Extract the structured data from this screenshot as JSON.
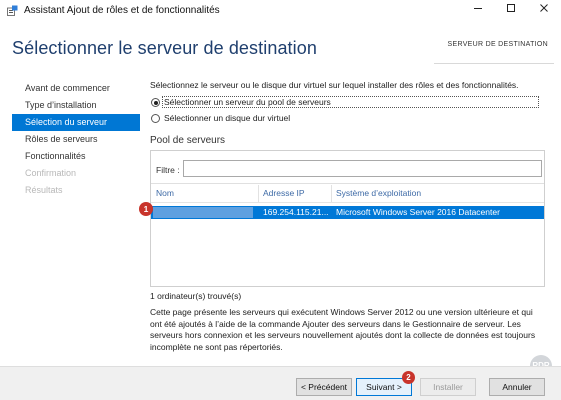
{
  "window": {
    "title": "Assistant Ajout de rôles et de fonctionnalités",
    "minimize_icon": "minimize-icon",
    "maximize_icon": "maximize-icon",
    "close_icon": "close-icon"
  },
  "page": {
    "heading": "Sélectionner le serveur de destination",
    "destination_label": "SERVEUR DE DESTINATION"
  },
  "nav": {
    "items": [
      {
        "label": "Avant de commencer",
        "state": "normal"
      },
      {
        "label": "Type d’installation",
        "state": "normal"
      },
      {
        "label": "Sélection du serveur",
        "state": "active"
      },
      {
        "label": "Rôles de serveurs",
        "state": "normal"
      },
      {
        "label": "Fonctionnalités",
        "state": "normal"
      },
      {
        "label": "Confirmation",
        "state": "disabled"
      },
      {
        "label": "Résultats",
        "state": "disabled"
      }
    ]
  },
  "main": {
    "intro": "Sélectionnez le serveur ou le disque dur virtuel sur lequel installer des rôles et des fonctionnalités.",
    "options": [
      {
        "label": "Sélectionner un serveur du pool de serveurs",
        "selected": true
      },
      {
        "label": "Sélectionner un disque dur virtuel",
        "selected": false
      }
    ],
    "pool_title": "Pool de serveurs",
    "filter_label": "Filtre :",
    "filter_value": "",
    "columns": [
      "Nom",
      "Adresse IP",
      "Système d’exploitation"
    ],
    "rows": [
      {
        "name": "",
        "ip": "169.254.115.21...",
        "os": "Microsoft Windows Server 2016 Datacenter",
        "selected": true
      }
    ],
    "row_badge": "1",
    "count_text": "1 ordinateur(s) trouvé(s)",
    "description": "Cette page présente les serveurs qui exécutent Windows Server 2012 ou une version ultérieure et qui ont été ajoutés à l’aide de la commande Ajouter des serveurs dans le Gestionnaire de serveur. Les serveurs hors connexion et les serveurs nouvellement ajoutés dont la collecte de données est toujours incomplète ne sont pas répertoriés."
  },
  "footer": {
    "prev_label": "< Précédent",
    "next_label": "Suivant >",
    "install_label": "Installer",
    "cancel_label": "Annuler",
    "next_badge": "2"
  },
  "watermark": {
    "text": "RDR"
  },
  "colors": {
    "accent": "#0078d7",
    "heading": "#1f3f6e",
    "badge": "#c8342b"
  }
}
